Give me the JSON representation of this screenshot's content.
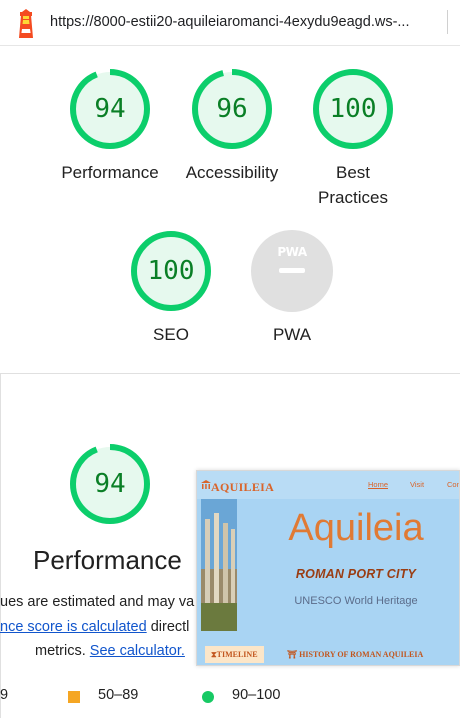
{
  "browser": {
    "url": "https://8000-estii20-aquileiaromanci-4exydu9eagd.ws-..."
  },
  "colors": {
    "pass_green": "#0cce6b",
    "pass_fill": "#e6f9ee",
    "pass_text": "#0a7f26",
    "average_orange": "#f5a623",
    "link_blue": "#1155cc",
    "pwa_gray": "#e0e0e0"
  },
  "scores": [
    {
      "label": "Performance",
      "score": "94",
      "value": 94
    },
    {
      "label": "Accessibility",
      "score": "96",
      "value": 96
    },
    {
      "label": "Best Practices",
      "label_line1": "Best",
      "label_line2": "Practices",
      "score": "100",
      "value": 100
    },
    {
      "label": "SEO",
      "score": "100",
      "value": 100
    },
    {
      "label": "PWA",
      "icon": "pwa-icon",
      "badge_text": "PWA"
    }
  ],
  "performance_section": {
    "score": "94",
    "value": 94,
    "title": "Performance",
    "desc_line1": "ues are estimated and may va",
    "desc_link": "nce score is calculated",
    "desc_line2_rest": " directl",
    "desc_line3_prefix": "metrics. ",
    "calculator_link": "See calculator."
  },
  "thumbnail": {
    "brand": "AQUILEIA",
    "nav_links": [
      "Home",
      "Visit",
      "Con"
    ],
    "title": "Aquileia",
    "subtitle": "ROMAN PORT CITY",
    "tagline": "UNESCO World Heritage",
    "tabs": [
      "TIMELINE",
      "HISTORY OF ROMAN AQUILEIA"
    ]
  },
  "legend": [
    {
      "range": "9",
      "kind": "fail-truncated"
    },
    {
      "range": "50–89",
      "kind": "average"
    },
    {
      "range": "90–100",
      "kind": "pass"
    }
  ]
}
